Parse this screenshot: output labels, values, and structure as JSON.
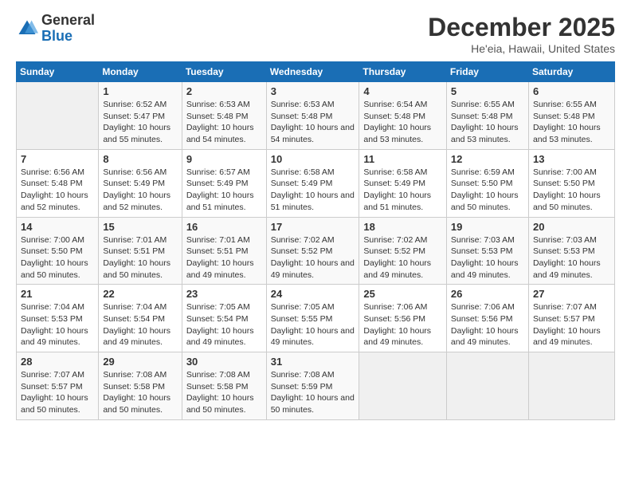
{
  "header": {
    "logo_line1": "General",
    "logo_line2": "Blue",
    "month_title": "December 2025",
    "location": "He'eia, Hawaii, United States"
  },
  "days_of_week": [
    "Sunday",
    "Monday",
    "Tuesday",
    "Wednesday",
    "Thursday",
    "Friday",
    "Saturday"
  ],
  "weeks": [
    [
      {
        "num": "",
        "sunrise": "",
        "sunset": "",
        "daylight": "",
        "empty": true
      },
      {
        "num": "1",
        "sunrise": "Sunrise: 6:52 AM",
        "sunset": "Sunset: 5:47 PM",
        "daylight": "Daylight: 10 hours and 55 minutes."
      },
      {
        "num": "2",
        "sunrise": "Sunrise: 6:53 AM",
        "sunset": "Sunset: 5:48 PM",
        "daylight": "Daylight: 10 hours and 54 minutes."
      },
      {
        "num": "3",
        "sunrise": "Sunrise: 6:53 AM",
        "sunset": "Sunset: 5:48 PM",
        "daylight": "Daylight: 10 hours and 54 minutes."
      },
      {
        "num": "4",
        "sunrise": "Sunrise: 6:54 AM",
        "sunset": "Sunset: 5:48 PM",
        "daylight": "Daylight: 10 hours and 53 minutes."
      },
      {
        "num": "5",
        "sunrise": "Sunrise: 6:55 AM",
        "sunset": "Sunset: 5:48 PM",
        "daylight": "Daylight: 10 hours and 53 minutes."
      },
      {
        "num": "6",
        "sunrise": "Sunrise: 6:55 AM",
        "sunset": "Sunset: 5:48 PM",
        "daylight": "Daylight: 10 hours and 53 minutes."
      }
    ],
    [
      {
        "num": "7",
        "sunrise": "Sunrise: 6:56 AM",
        "sunset": "Sunset: 5:48 PM",
        "daylight": "Daylight: 10 hours and 52 minutes."
      },
      {
        "num": "8",
        "sunrise": "Sunrise: 6:56 AM",
        "sunset": "Sunset: 5:49 PM",
        "daylight": "Daylight: 10 hours and 52 minutes."
      },
      {
        "num": "9",
        "sunrise": "Sunrise: 6:57 AM",
        "sunset": "Sunset: 5:49 PM",
        "daylight": "Daylight: 10 hours and 51 minutes."
      },
      {
        "num": "10",
        "sunrise": "Sunrise: 6:58 AM",
        "sunset": "Sunset: 5:49 PM",
        "daylight": "Daylight: 10 hours and 51 minutes."
      },
      {
        "num": "11",
        "sunrise": "Sunrise: 6:58 AM",
        "sunset": "Sunset: 5:49 PM",
        "daylight": "Daylight: 10 hours and 51 minutes."
      },
      {
        "num": "12",
        "sunrise": "Sunrise: 6:59 AM",
        "sunset": "Sunset: 5:50 PM",
        "daylight": "Daylight: 10 hours and 50 minutes."
      },
      {
        "num": "13",
        "sunrise": "Sunrise: 7:00 AM",
        "sunset": "Sunset: 5:50 PM",
        "daylight": "Daylight: 10 hours and 50 minutes."
      }
    ],
    [
      {
        "num": "14",
        "sunrise": "Sunrise: 7:00 AM",
        "sunset": "Sunset: 5:50 PM",
        "daylight": "Daylight: 10 hours and 50 minutes."
      },
      {
        "num": "15",
        "sunrise": "Sunrise: 7:01 AM",
        "sunset": "Sunset: 5:51 PM",
        "daylight": "Daylight: 10 hours and 50 minutes."
      },
      {
        "num": "16",
        "sunrise": "Sunrise: 7:01 AM",
        "sunset": "Sunset: 5:51 PM",
        "daylight": "Daylight: 10 hours and 49 minutes."
      },
      {
        "num": "17",
        "sunrise": "Sunrise: 7:02 AM",
        "sunset": "Sunset: 5:52 PM",
        "daylight": "Daylight: 10 hours and 49 minutes."
      },
      {
        "num": "18",
        "sunrise": "Sunrise: 7:02 AM",
        "sunset": "Sunset: 5:52 PM",
        "daylight": "Daylight: 10 hours and 49 minutes."
      },
      {
        "num": "19",
        "sunrise": "Sunrise: 7:03 AM",
        "sunset": "Sunset: 5:53 PM",
        "daylight": "Daylight: 10 hours and 49 minutes."
      },
      {
        "num": "20",
        "sunrise": "Sunrise: 7:03 AM",
        "sunset": "Sunset: 5:53 PM",
        "daylight": "Daylight: 10 hours and 49 minutes."
      }
    ],
    [
      {
        "num": "21",
        "sunrise": "Sunrise: 7:04 AM",
        "sunset": "Sunset: 5:53 PM",
        "daylight": "Daylight: 10 hours and 49 minutes."
      },
      {
        "num": "22",
        "sunrise": "Sunrise: 7:04 AM",
        "sunset": "Sunset: 5:54 PM",
        "daylight": "Daylight: 10 hours and 49 minutes."
      },
      {
        "num": "23",
        "sunrise": "Sunrise: 7:05 AM",
        "sunset": "Sunset: 5:54 PM",
        "daylight": "Daylight: 10 hours and 49 minutes."
      },
      {
        "num": "24",
        "sunrise": "Sunrise: 7:05 AM",
        "sunset": "Sunset: 5:55 PM",
        "daylight": "Daylight: 10 hours and 49 minutes."
      },
      {
        "num": "25",
        "sunrise": "Sunrise: 7:06 AM",
        "sunset": "Sunset: 5:56 PM",
        "daylight": "Daylight: 10 hours and 49 minutes."
      },
      {
        "num": "26",
        "sunrise": "Sunrise: 7:06 AM",
        "sunset": "Sunset: 5:56 PM",
        "daylight": "Daylight: 10 hours and 49 minutes."
      },
      {
        "num": "27",
        "sunrise": "Sunrise: 7:07 AM",
        "sunset": "Sunset: 5:57 PM",
        "daylight": "Daylight: 10 hours and 49 minutes."
      }
    ],
    [
      {
        "num": "28",
        "sunrise": "Sunrise: 7:07 AM",
        "sunset": "Sunset: 5:57 PM",
        "daylight": "Daylight: 10 hours and 50 minutes."
      },
      {
        "num": "29",
        "sunrise": "Sunrise: 7:08 AM",
        "sunset": "Sunset: 5:58 PM",
        "daylight": "Daylight: 10 hours and 50 minutes."
      },
      {
        "num": "30",
        "sunrise": "Sunrise: 7:08 AM",
        "sunset": "Sunset: 5:58 PM",
        "daylight": "Daylight: 10 hours and 50 minutes."
      },
      {
        "num": "31",
        "sunrise": "Sunrise: 7:08 AM",
        "sunset": "Sunset: 5:59 PM",
        "daylight": "Daylight: 10 hours and 50 minutes."
      },
      {
        "num": "",
        "sunrise": "",
        "sunset": "",
        "daylight": "",
        "empty": true
      },
      {
        "num": "",
        "sunrise": "",
        "sunset": "",
        "daylight": "",
        "empty": true
      },
      {
        "num": "",
        "sunrise": "",
        "sunset": "",
        "daylight": "",
        "empty": true
      }
    ]
  ]
}
